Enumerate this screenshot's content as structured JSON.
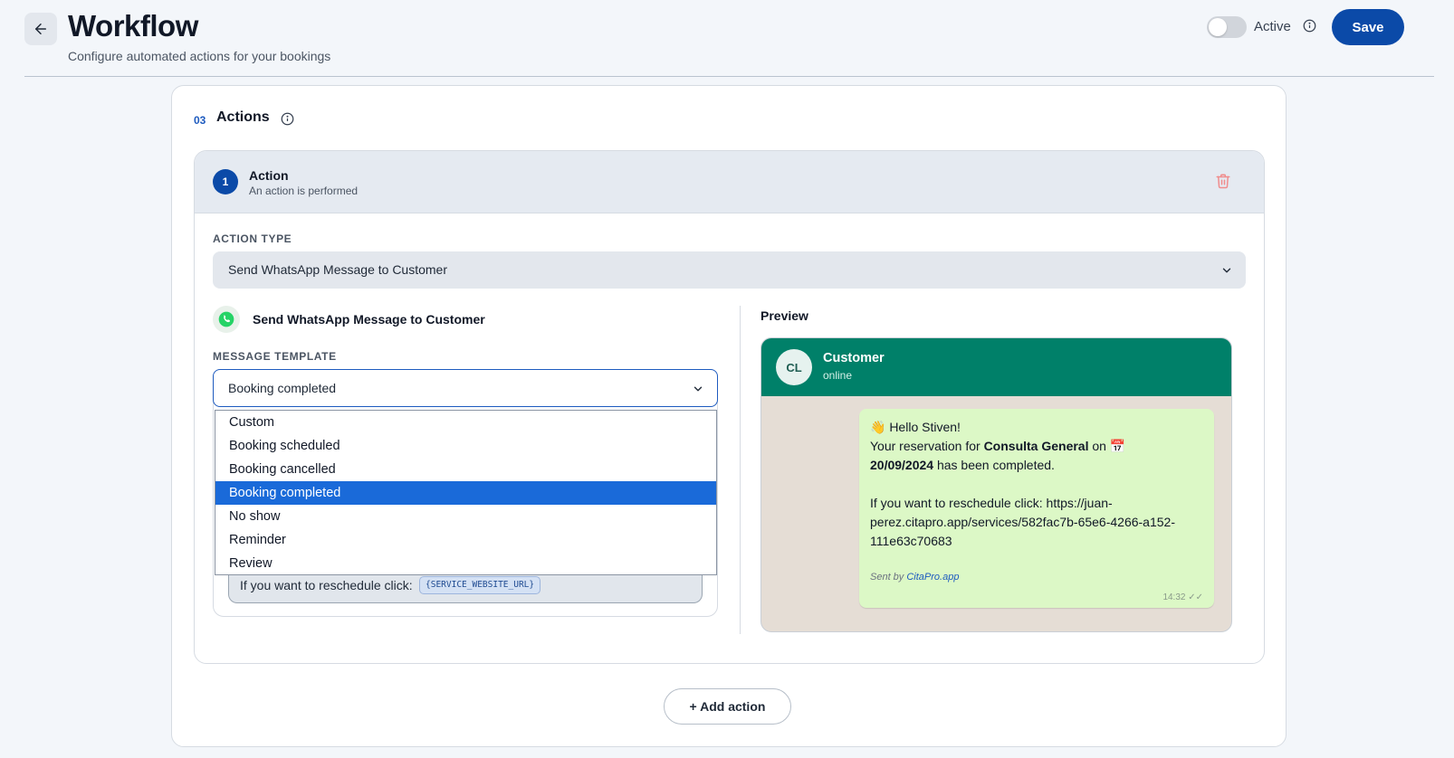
{
  "header": {
    "title": "Workflow",
    "subtitle": "Configure automated actions for your bookings",
    "active_label": "Active",
    "active_on": false,
    "save_label": "Save"
  },
  "section": {
    "step": "03",
    "title": "Actions"
  },
  "action": {
    "number": "1",
    "title": "Action",
    "subtitle": "An action is performed",
    "type_label": "ACTION TYPE",
    "type_value": "Send WhatsApp Message to Customer",
    "channel_title": "Send WhatsApp Message to Customer",
    "template_label": "MESSAGE TEMPLATE",
    "template_value": "Booking completed",
    "template_options": [
      {
        "label": "Custom",
        "selected": false
      },
      {
        "label": "Booking scheduled",
        "selected": false
      },
      {
        "label": "Booking cancelled",
        "selected": false
      },
      {
        "label": "Booking completed",
        "selected": true
      },
      {
        "label": "No show",
        "selected": false
      },
      {
        "label": "Reminder",
        "selected": false
      },
      {
        "label": "Review",
        "selected": false
      }
    ],
    "message_line": "If you want to reschedule click:",
    "message_var": "{SERVICE_WEBSITE_URL}"
  },
  "preview": {
    "label": "Preview",
    "contact_initials": "CL",
    "contact_name": "Customer",
    "contact_status": "online",
    "greeting": "👋 Hello Stiven!",
    "line2_pre": "Your reservation for ",
    "line2_bold": "Consulta General",
    "line2_post": " on 📅",
    "line3_bold": "20/09/2024",
    "line3_post": " has been completed.",
    "reschedule_line1": "If you want to reschedule click: https://juan-",
    "reschedule_line2": "perez.citapro.app/services/582fac7b-65e6-4266-a152-",
    "reschedule_line3": "111e63c70683",
    "sent_by": "Sent by ",
    "sent_by_link": "CitaPro.app",
    "time": "14:32 ✓✓"
  },
  "add_action_label": "+ Add action",
  "colors": {
    "primary": "#0b4aa8",
    "whatsapp_header": "#008069",
    "bubble": "#dcf8c6",
    "selected_option": "#1a6ad9"
  }
}
